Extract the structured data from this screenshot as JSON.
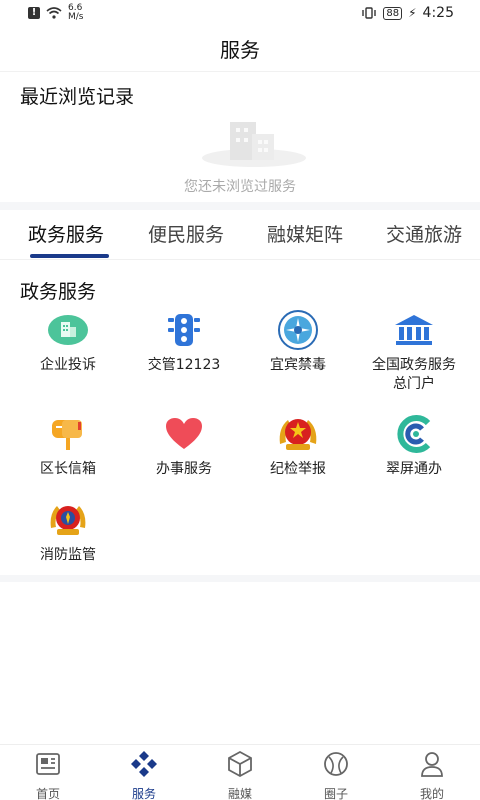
{
  "status_bar": {
    "speed_value": "6.6",
    "speed_unit": "M/s",
    "battery": "88",
    "time": "4:25"
  },
  "header": {
    "title": "服务"
  },
  "recent": {
    "title": "最近浏览记录",
    "empty_text": "您还未浏览过服务"
  },
  "tabs": [
    {
      "label": "政务服务",
      "active": true
    },
    {
      "label": "便民服务",
      "active": false
    },
    {
      "label": "融媒矩阵",
      "active": false
    },
    {
      "label": "交通旅游",
      "active": false
    }
  ],
  "services": {
    "title": "政务服务",
    "items": [
      {
        "label": "企业投诉",
        "icon": "building-icon"
      },
      {
        "label": "交管12123",
        "icon": "traffic-light-icon"
      },
      {
        "label": "宜宾禁毒",
        "icon": "anti-drug-emblem-icon"
      },
      {
        "label": "全国政务服务总门户",
        "icon": "government-building-icon"
      },
      {
        "label": "区长信箱",
        "icon": "mailbox-icon"
      },
      {
        "label": "办事服务",
        "icon": "heart-icon"
      },
      {
        "label": "纪检举报",
        "icon": "national-emblem-icon"
      },
      {
        "label": "翠屏通办",
        "icon": "cuiping-logo-icon"
      },
      {
        "label": "消防监管",
        "icon": "fire-badge-icon"
      }
    ]
  },
  "bottom_nav": [
    {
      "label": "首页",
      "icon": "newspaper-icon",
      "active": false
    },
    {
      "label": "服务",
      "icon": "diamond-grid-icon",
      "active": true
    },
    {
      "label": "融媒",
      "icon": "cube-icon",
      "active": false
    },
    {
      "label": "圈子",
      "icon": "circle-icon",
      "active": false
    },
    {
      "label": "我的",
      "icon": "user-icon",
      "active": false
    }
  ],
  "colors": {
    "accent": "#1a3a8a",
    "tab_indicator": "#1a3a8a",
    "green": "#4cc49a",
    "blue": "#2f74d8",
    "orange": "#f5a623",
    "red": "#ef4c58"
  }
}
